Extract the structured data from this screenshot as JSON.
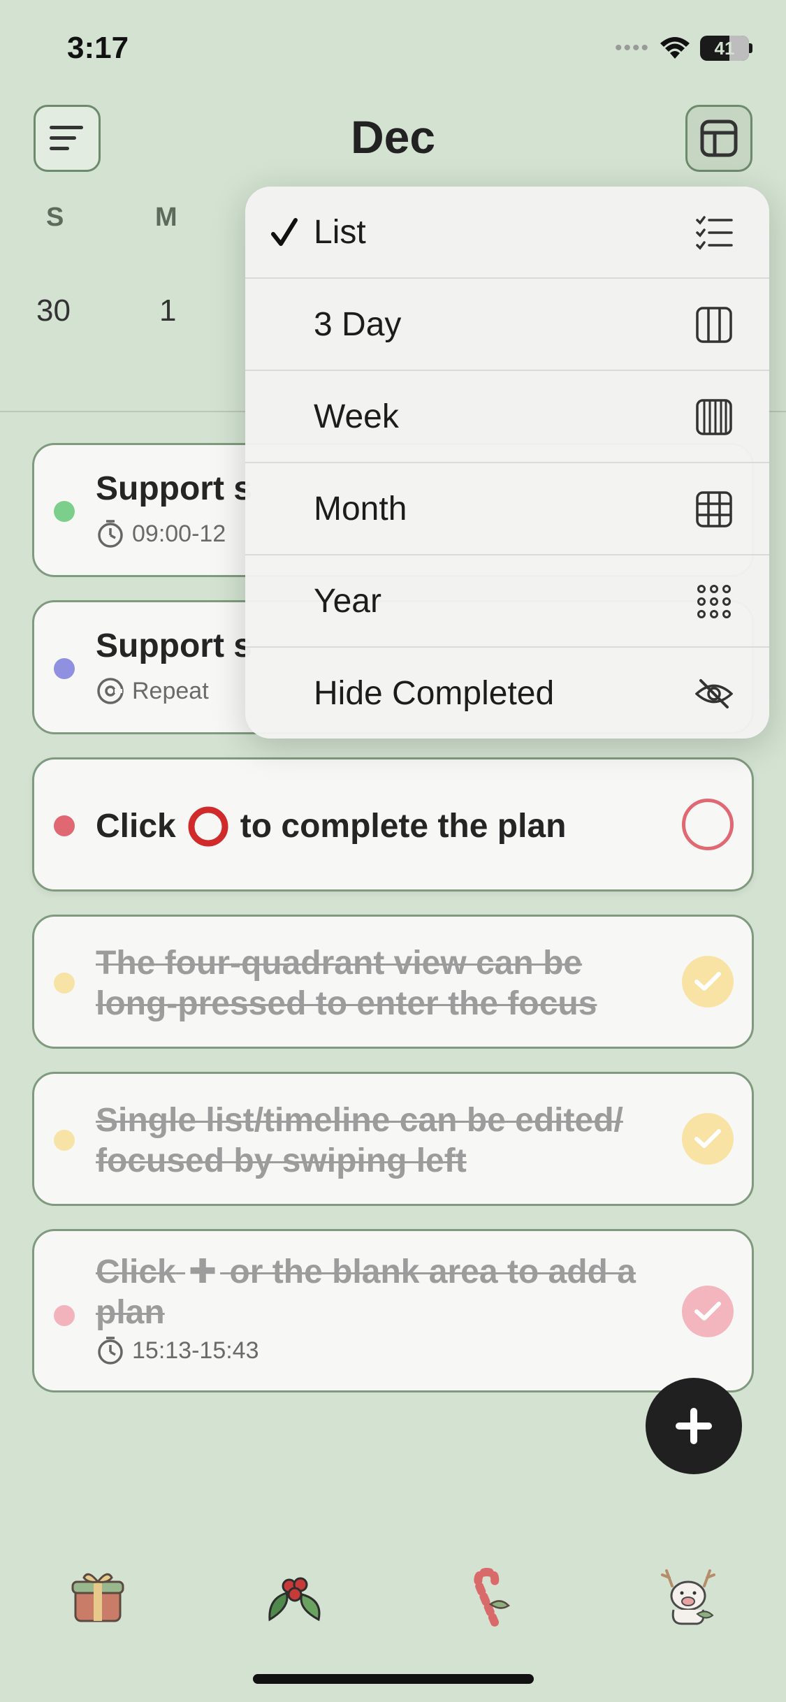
{
  "status_bar": {
    "time": "3:17",
    "battery": "41"
  },
  "header": {
    "month": "Dec"
  },
  "week": {
    "letters": [
      "S",
      "M"
    ],
    "days": [
      "30",
      "1"
    ]
  },
  "tasks": [
    {
      "title": "Support s",
      "subtitle": "09:00-12",
      "dot_color": "#7ccf8a",
      "completed": false
    },
    {
      "title": "Support s",
      "subtitle": "Repeat",
      "dot_color": "#8f90e0",
      "completed": false
    },
    {
      "title_before": "Click",
      "title_after": "to complete the plan",
      "dot_color": "#e06872",
      "completed": false
    },
    {
      "title": "The four-quadrant view can be long-pressed to enter the focus",
      "dot_color": "#f7e3a6",
      "completed": true
    },
    {
      "title": "Single list/timeline can be edited/ focused by swiping left",
      "dot_color": "#f7e3a6",
      "completed": true
    },
    {
      "title_before": "Click",
      "title_after": "or the blank area to add a plan",
      "subtitle": "15:13-15:43",
      "dot_color": "#f2b3bd",
      "completed": true
    }
  ],
  "view_menu": {
    "items": [
      {
        "label": "List",
        "icon": "list-check-icon",
        "selected": true
      },
      {
        "label": "3 Day",
        "icon": "three-column-icon",
        "selected": false
      },
      {
        "label": "Week",
        "icon": "week-columns-icon",
        "selected": false
      },
      {
        "label": "Month",
        "icon": "grid-icon",
        "selected": false
      },
      {
        "label": "Year",
        "icon": "dot-grid-icon",
        "selected": false
      },
      {
        "label": "Hide Completed",
        "icon": "eye-slash-icon",
        "selected": false
      }
    ]
  },
  "tab_bar": {
    "tabs": [
      "gift-icon",
      "holly-icon",
      "candy-cane-icon",
      "reindeer-icon"
    ]
  },
  "colors": {
    "background": "#d3e2d1",
    "card_border": "#7f9a7e",
    "accent_red": "#e06872",
    "done_yellow": "#f8e3a5",
    "done_pink": "#f4b6be"
  }
}
